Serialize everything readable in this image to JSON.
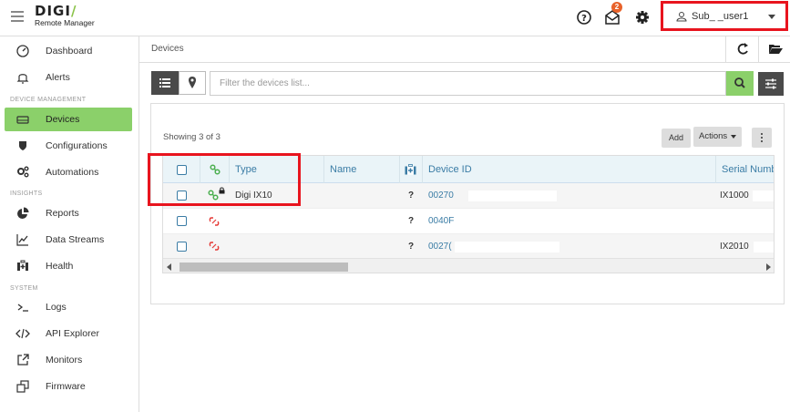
{
  "app": {
    "logo_main": "DIGI",
    "logo_sub": "Remote Manager",
    "notification_count": "2",
    "user_name": "Sub_        _user1"
  },
  "sidebar": {
    "items": [
      {
        "label": "Dashboard",
        "icon": "dashboard-icon"
      },
      {
        "label": "Alerts",
        "icon": "bell-icon"
      },
      {
        "label": "Devices",
        "icon": "device-icon",
        "active": true
      },
      {
        "label": "Configurations",
        "icon": "shield-icon"
      },
      {
        "label": "Automations",
        "icon": "gears-icon"
      },
      {
        "label": "Reports",
        "icon": "pie-chart-icon"
      },
      {
        "label": "Data Streams",
        "icon": "line-chart-icon"
      },
      {
        "label": "Health",
        "icon": "medkit-icon"
      },
      {
        "label": "Logs",
        "icon": "terminal-icon"
      },
      {
        "label": "API Explorer",
        "icon": "code-icon"
      },
      {
        "label": "Monitors",
        "icon": "external-link-icon"
      },
      {
        "label": "Firmware",
        "icon": "clone-icon"
      }
    ],
    "sections": {
      "device_management": "DEVICE MANAGEMENT",
      "insights": "INSIGHTS",
      "system": "SYSTEM"
    }
  },
  "breadcrumb": "Devices",
  "filter": {
    "placeholder": "Filter the devices list..."
  },
  "toolbar": {
    "showing": "Showing 3 of 3",
    "add_label": "Add",
    "actions_label": "Actions"
  },
  "table": {
    "columns": {
      "type": "Type",
      "name": "Name",
      "device_id": "Device ID",
      "serial": "Serial Numb"
    },
    "rows": [
      {
        "connected": true,
        "locked": true,
        "type": "Digi IX10",
        "name": "",
        "health": "?",
        "device_id": "00270",
        "serial": "IX1000"
      },
      {
        "connected": false,
        "locked": false,
        "type": "",
        "name": "",
        "health": "?",
        "device_id": "0040F",
        "serial": ""
      },
      {
        "connected": false,
        "locked": false,
        "type": "",
        "name": "",
        "health": "?",
        "device_id": "0027(",
        "serial": "IX2010"
      }
    ]
  },
  "colors": {
    "accent_green": "#8bd06a",
    "link_blue": "#3a7ca5",
    "highlight_red": "#e8141e",
    "badge_orange": "#e8622a"
  }
}
